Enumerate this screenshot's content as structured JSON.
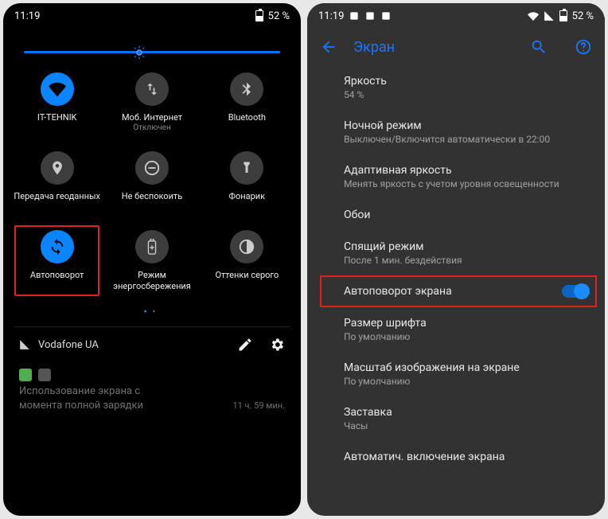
{
  "left": {
    "status": {
      "time": "11:19",
      "battery_pct": "52 %"
    },
    "qs": [
      {
        "id": "wifi",
        "label": "IT-TEHNIK",
        "sub": "",
        "active": true,
        "icon": "wifi"
      },
      {
        "id": "mobile-data",
        "label": "Моб. Интернет",
        "sub": "Отключен",
        "active": false,
        "icon": "swap"
      },
      {
        "id": "bluetooth",
        "label": "Bluetooth",
        "sub": "",
        "active": false,
        "icon": "bluetooth"
      },
      {
        "id": "location",
        "label": "Передача геоданных",
        "sub": "",
        "active": false,
        "icon": "location"
      },
      {
        "id": "dnd",
        "label": "Не беспокоить",
        "sub": "",
        "active": false,
        "icon": "dnd"
      },
      {
        "id": "flashlight",
        "label": "Фонарик",
        "sub": "",
        "active": false,
        "icon": "flashlight"
      },
      {
        "id": "autorotate",
        "label": "Автоповорот",
        "sub": "",
        "active": true,
        "icon": "rotate",
        "highlight": true
      },
      {
        "id": "battery-saver",
        "label": "Режим энергосбережения",
        "sub": "",
        "active": false,
        "icon": "battery"
      },
      {
        "id": "grayscale",
        "label": "Оттенки серого",
        "sub": "",
        "active": false,
        "icon": "contrast"
      }
    ],
    "carrier": "Vodafone UA",
    "notification": {
      "line1": "Использование экрана с",
      "line2": "момента полной зарядки",
      "duration": "11 ч. 59 мин."
    }
  },
  "right": {
    "status": {
      "time": "11:19",
      "battery_pct": "52 %"
    },
    "title": "Экран",
    "items": [
      {
        "id": "brightness",
        "title": "Яркость",
        "sub": "54 %"
      },
      {
        "id": "night-mode",
        "title": "Ночной режим",
        "sub": "Выключен/Включится автоматически в 22:00"
      },
      {
        "id": "adaptive",
        "title": "Адаптивная яркость",
        "sub": "Менять яркость с учетом уровня освещенности"
      },
      {
        "id": "wallpaper",
        "title": "Обои",
        "sub": ""
      },
      {
        "id": "sleep",
        "title": "Спящий режим",
        "sub": "После 1 мин. бездействия"
      },
      {
        "id": "autorotate",
        "title": "Автоповорот экрана",
        "sub": "",
        "switch": true,
        "highlight": true
      },
      {
        "id": "font-size",
        "title": "Размер шрифта",
        "sub": "По умолчанию"
      },
      {
        "id": "display-size",
        "title": "Масштаб изображения на экране",
        "sub": "По умолчанию"
      },
      {
        "id": "screensaver",
        "title": "Заставка",
        "sub": "Часы"
      },
      {
        "id": "auto-on",
        "title": "Автоматич. включение экрана",
        "sub": ""
      }
    ]
  }
}
